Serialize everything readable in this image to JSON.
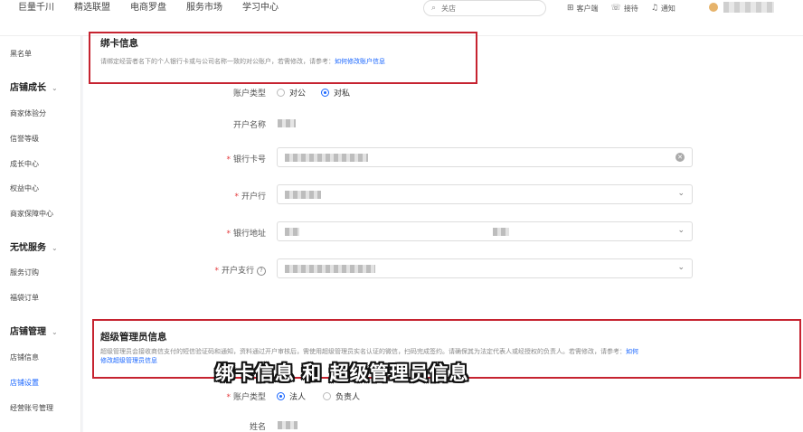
{
  "topnav": {
    "items": [
      "巨量千川",
      "精选联盟",
      "电商罗盘",
      "服务市场",
      "学习中心"
    ],
    "search_placeholder": "关店",
    "tools": [
      {
        "icon": "plus-square-icon",
        "glyph": "⊞",
        "label": "客户端"
      },
      {
        "icon": "headset-icon",
        "glyph": "☏",
        "label": "接待"
      },
      {
        "icon": "bell-icon",
        "glyph": "♫",
        "label": "通知"
      }
    ]
  },
  "sidebar": {
    "items": [
      {
        "type": "item",
        "label": "黑名单"
      },
      {
        "type": "group",
        "label": "店铺成长"
      },
      {
        "type": "item",
        "label": "商家体验分"
      },
      {
        "type": "item",
        "label": "信誉等级"
      },
      {
        "type": "item",
        "label": "成长中心"
      },
      {
        "type": "item",
        "label": "权益中心"
      },
      {
        "type": "item",
        "label": "商家保障中心"
      },
      {
        "type": "group",
        "label": "无忧服务"
      },
      {
        "type": "item",
        "label": "服务订购"
      },
      {
        "type": "item",
        "label": "福袋订单"
      },
      {
        "type": "group",
        "label": "店铺管理"
      },
      {
        "type": "item",
        "label": "店铺信息"
      },
      {
        "type": "item",
        "label": "店铺设置",
        "active": true
      },
      {
        "type": "item",
        "label": "经营账号管理"
      }
    ]
  },
  "bank_card": {
    "title": "绑卡信息",
    "desc": "请绑定经营者名下的个人银行卡或与公司名称一致的对公账户，若需修改，请参考：",
    "link": "如何修改账户信息",
    "account_type_label": "账户类型",
    "account_types": [
      {
        "label": "对公",
        "checked": false
      },
      {
        "label": "对私",
        "checked": true
      }
    ],
    "account_name_label": "开户名称",
    "card_number_label": "银行卡号",
    "bank_label": "开户行",
    "bank_address_label": "银行地址",
    "branch_label": "开户支行"
  },
  "super_admin": {
    "title": "超级管理员信息",
    "desc": "超级管理员会接收商信支付的短信验证码和通知，资料通过开户审核后，需使用超级管理员实名认证的微信，扫码完成签约。请确保其为法定代表人或经授权的负责人。若需修改，请参考：",
    "link_part1": "如何",
    "link_part2": "修改超级管理员信息",
    "account_type_label": "账户类型",
    "account_types": [
      {
        "label": "法人",
        "checked": true
      },
      {
        "label": "负责人",
        "checked": false
      }
    ],
    "name_label": "姓名"
  },
  "subtitle": "绑卡信息 和 超级管理员信息",
  "colors": {
    "accent": "#1966ff",
    "highlight": "#c62330",
    "required": "#e4393c"
  }
}
